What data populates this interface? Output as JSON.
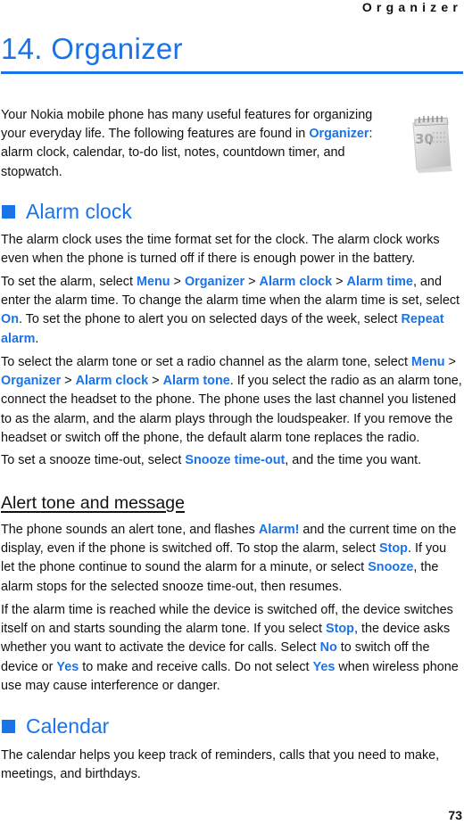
{
  "running_header": "Organizer",
  "chapter": {
    "title": "14. Organizer"
  },
  "colors": {
    "accent": "#1a74e8",
    "text": "#111111"
  },
  "intro": {
    "t1": "Your Nokia mobile phone has many useful features for organizing your everyday life. The following features are found in ",
    "h1": "Organizer",
    "t2": ": alarm clock, calendar, to-do list, notes, countdown timer, and stopwatch.",
    "icon": "calendar-icon"
  },
  "alarm_clock": {
    "title": "Alarm clock",
    "p1": "The alarm clock uses the time format set for the clock. The alarm clock works even when the phone is turned off if there is enough power in the battery.",
    "p2": {
      "t1": "To set the alarm, select ",
      "h1": "Menu",
      "s1": " > ",
      "h2": "Organizer",
      "s2": " > ",
      "h3": "Alarm clock",
      "s3": " > ",
      "h4": "Alarm time",
      "t2": ", and enter the alarm time. To change the alarm time when the alarm time is set, select ",
      "h5": "On",
      "t3": ". To set the phone to alert you on selected days of the week, select ",
      "h6": "Repeat alarm",
      "t4": "."
    },
    "p3": {
      "t1": "To select the alarm tone or set a radio channel as the alarm tone, select ",
      "h1": "Menu",
      "s1": " > ",
      "h2": "Organizer",
      "s2": " > ",
      "h3": "Alarm clock",
      "s3": " > ",
      "h4": "Alarm tone",
      "t2": ". If you select the radio as an alarm tone, connect the headset to the phone. The phone uses the last channel you listened to as the alarm, and the alarm plays through the loudspeaker. If you remove the headset or switch off the phone, the default alarm tone replaces the radio."
    },
    "p4": {
      "t1": "To set a snooze time-out, select ",
      "h1": "Snooze time-out",
      "t2": ", and the time you want."
    }
  },
  "alert_tone": {
    "title": "Alert tone and message",
    "p1": {
      "t1": "The phone sounds an alert tone, and flashes ",
      "h1": "Alarm!",
      "t2": " and the current time on the display, even if the phone is switched off. To stop the alarm, select ",
      "h2": "Stop",
      "t3": ". If you let the phone continue to sound the alarm for a minute, or select ",
      "h3": "Snooze",
      "t4": ", the alarm stops for the selected snooze time-out, then resumes."
    },
    "p2": {
      "t1": "If the alarm time is reached while the device is switched off, the device switches itself on and starts sounding the alarm tone. If you select ",
      "h1": "Stop",
      "t2": ", the device asks whether you want to activate the device for calls. Select ",
      "h2": "No",
      "t3": " to switch off the device or ",
      "h3": "Yes",
      "t4": " to make and receive calls. Do not select ",
      "h4": "Yes",
      "t5": " when wireless phone use may cause interference or danger."
    }
  },
  "calendar": {
    "title": "Calendar",
    "p1": "The calendar helps you keep track of reminders, calls that you need to make, meetings, and birthdays."
  },
  "page_number": "73"
}
